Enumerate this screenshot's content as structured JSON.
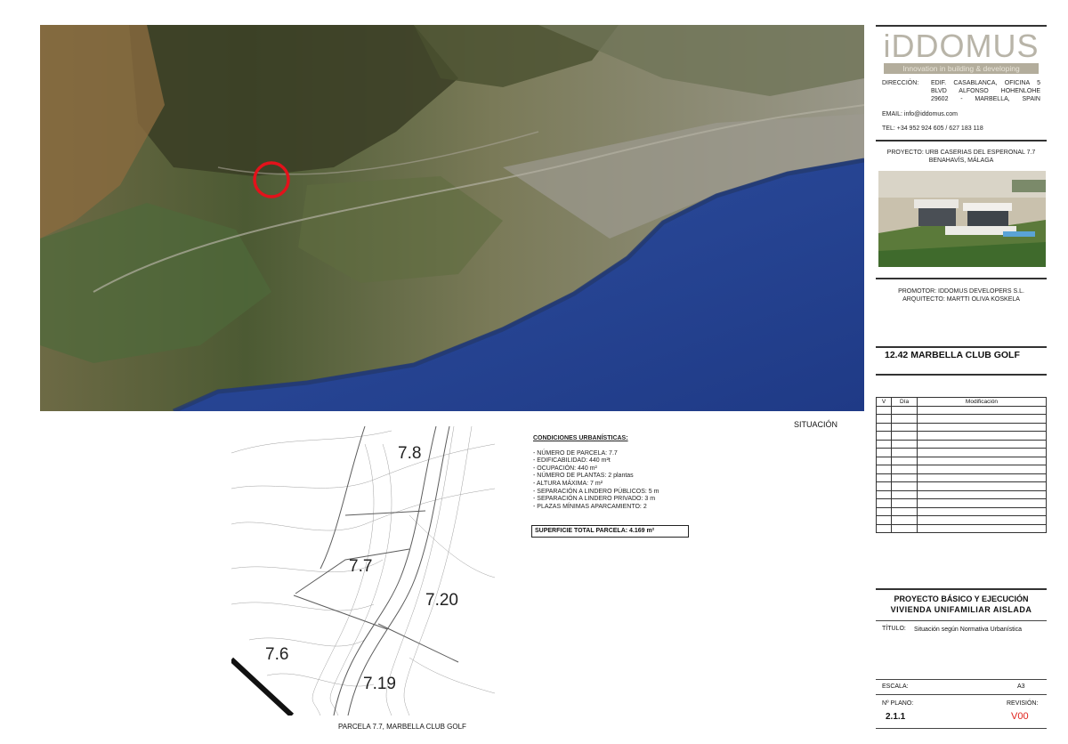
{
  "map_caption": "SITUACIÓN",
  "logo": {
    "text": "iDDOMUS",
    "tagline": "Innovation in building & developing"
  },
  "company": {
    "direccion_label": "DIRECCIÓN:",
    "direccion_lines": [
      "EDIF. CASABLANCA, OFICINA 5",
      "BLVD ALFONSO HOHENLOHE",
      "29602 - MARBELLA, SPAIN"
    ],
    "email": "EMAIL: info@iddomus.com",
    "tel": "TEL: +34 952 924 605 / 627 183 118"
  },
  "project": {
    "line1": "PROYECTO: URB CASERIAS DEL ESPERONAL 7.7",
    "line2": "BENAHAVÍS, MÁLAGA"
  },
  "credits": {
    "promotor": "PROMOTOR: IDDOMUS DEVELOPERS S.L.",
    "arquitecto": "ARQUITECTO: MARTTI OLIVA KOSKELA"
  },
  "location_title": "12.42 MARBELLA CLUB GOLF",
  "revision_table": {
    "headers": [
      "V",
      "Día",
      "Modificación"
    ],
    "empty_rows": 15
  },
  "project_type": {
    "line1": "PROYECTO BÁSICO Y EJECUCIÓN",
    "line2": "VIVIENDA UNIFAMILIAR AISLADA"
  },
  "titulo": {
    "label": "TÍTULO:",
    "value": "Situación según Normativa Urbanística"
  },
  "escala": {
    "label": "ESCALA:",
    "value": "A3"
  },
  "plano": {
    "label": "Nº PLANO:",
    "value": "2.1.1"
  },
  "revision": {
    "label": "REVISIÓN:",
    "value": "V00",
    "color": "#e0211b"
  },
  "conditions": {
    "title": "CONDICIONES URBANÍSTICAS:",
    "items": [
      "- NÚMERO DE PARCELA: 7.7",
      "- EDIFICABILIDAD: 440 m²t",
      "- OCUPACIÓN: 440 m²",
      "- NÚMERO DE PLANTAS: 2 plantas",
      "- ALTURA MÁXIMA: 7 m²",
      "- SEPARACIÓN A LINDERO PÚBLICOS: 5 m",
      "- SEPARACIÓN A LINDERO PRIVADO: 3 m",
      "- PLAZAS MÍNIMAS APARCAMIENTO: 2"
    ],
    "total": "SUPERFICIE TOTAL PARCELA: 4.169 m²"
  },
  "plot_labels": {
    "p78": "7.8",
    "p77": "7.7",
    "p720": "7.20",
    "p76": "7.6",
    "p719": "7.19"
  },
  "plot_caption": "PARCELA 7.7, MARBELLA CLUB GOLF",
  "marker_color": "#e3121b"
}
